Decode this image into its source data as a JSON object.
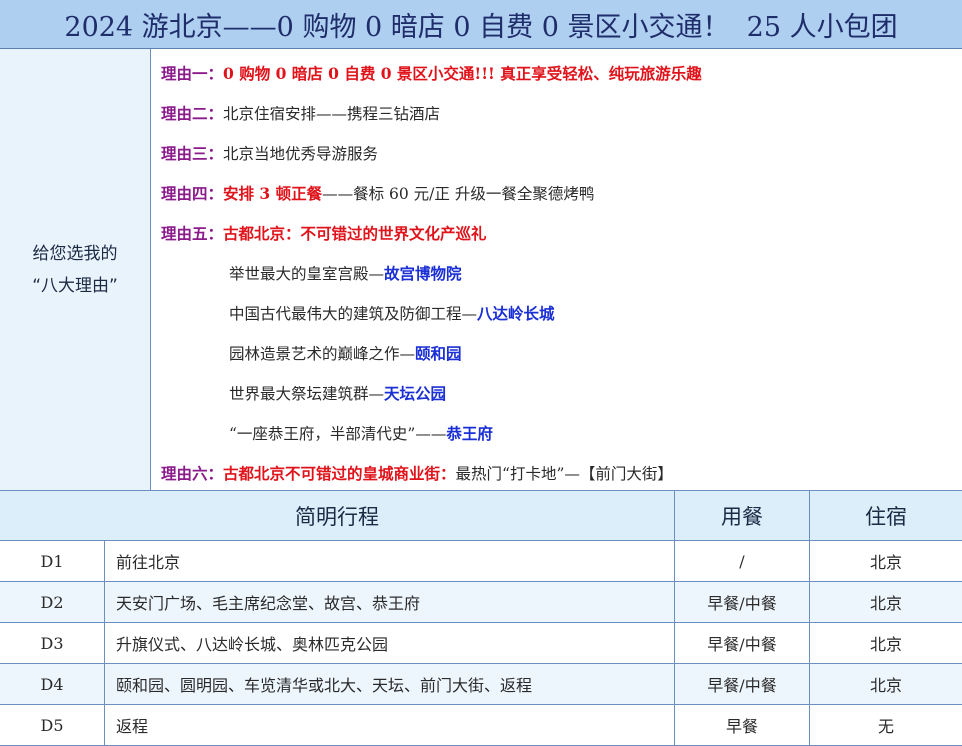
{
  "title": "2024 游北京——0 购物 0 暗店 0 自费 0 景区小交通！  25 人小包团",
  "reasons_panel": {
    "heading_line1": "给您选我的",
    "heading_line2": "“八大理由”"
  },
  "reasons": [
    {
      "label": "理由一：",
      "parts": [
        {
          "text": "0 购物 0 暗店 0 自费 0 景区小交通!!! 真正享受轻松、纯玩旅游乐趣",
          "style": "red"
        }
      ]
    },
    {
      "label": "理由二：",
      "parts": [
        {
          "text": "北京住宿安排——携程三钻酒店",
          "style": "txt"
        }
      ]
    },
    {
      "label": "理由三：",
      "parts": [
        {
          "text": "北京当地优秀导游服务",
          "style": "txt"
        }
      ]
    },
    {
      "label": "理由四：",
      "parts": [
        {
          "text": "安排 3 顿正餐",
          "style": "red"
        },
        {
          "text": "——餐标 60 元/正  升级一餐全聚德烤鸭",
          "style": "txt"
        }
      ]
    },
    {
      "label": "理由五：",
      "parts": [
        {
          "text": "古都北京：不可错过的世界文化产巡礼",
          "style": "red"
        }
      ]
    },
    {
      "label": "",
      "parts": [
        {
          "text": "举世最大的皇室宫殿—",
          "style": "txt"
        },
        {
          "text": "故宫博物院",
          "style": "blue"
        }
      ]
    },
    {
      "label": "",
      "parts": [
        {
          "text": "中国古代最伟大的建筑及防御工程—",
          "style": "txt"
        },
        {
          "text": "八达岭长城",
          "style": "blue"
        }
      ]
    },
    {
      "label": "",
      "parts": [
        {
          "text": "园林造景艺术的巅峰之作—",
          "style": "txt"
        },
        {
          "text": "颐和园",
          "style": "blue"
        }
      ]
    },
    {
      "label": "",
      "parts": [
        {
          "text": "世界最大祭坛建筑群—",
          "style": "txt"
        },
        {
          "text": "天坛公园",
          "style": "blue"
        }
      ]
    },
    {
      "label": "",
      "parts": [
        {
          "text": "“一座恭王府，半部清代史”——",
          "style": "txt"
        },
        {
          "text": "恭王府",
          "style": "blue"
        }
      ]
    },
    {
      "label": "理由六：",
      "parts": [
        {
          "text": "古都北京不可错过的皇城商业街：",
          "style": "red"
        },
        {
          "text": "最热门“打卡地”—【前门大街】",
          "style": "txt"
        }
      ]
    }
  ],
  "itinerary": {
    "headers": {
      "route": "简明行程",
      "meal": "用餐",
      "stay": "住宿"
    },
    "rows": [
      {
        "day": "D1",
        "route": "前往北京",
        "meal": "/",
        "stay": "北京"
      },
      {
        "day": "D2",
        "route": "天安门广场、毛主席纪念堂、故宫、恭王府",
        "meal": "早餐/中餐",
        "stay": "北京"
      },
      {
        "day": "D3",
        "route": "升旗仪式、八达岭长城、奥林匹克公园",
        "meal": "早餐/中餐",
        "stay": "北京"
      },
      {
        "day": "D4",
        "route": "颐和园、圆明园、车览清华或北大、天坛、前门大街、返程",
        "meal": "早餐/中餐",
        "stay": "北京"
      },
      {
        "day": "D5",
        "route": "返程",
        "meal": "早餐",
        "stay": "无"
      }
    ]
  }
}
